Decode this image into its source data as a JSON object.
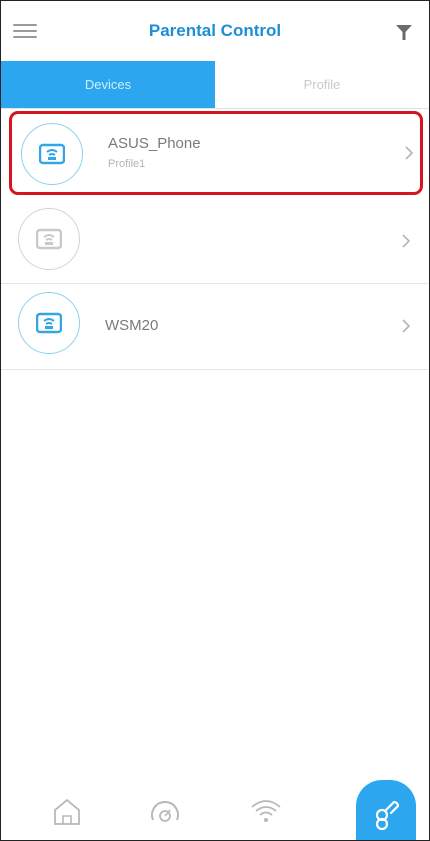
{
  "header": {
    "title": "Parental Control"
  },
  "tabs": [
    {
      "label": "Devices",
      "active": true
    },
    {
      "label": "Profile",
      "active": false
    }
  ],
  "devices": [
    {
      "name": "ASUS_Phone",
      "profile": "Profile1",
      "selected": true
    },
    {
      "name": "",
      "profile": "",
      "selected": false
    },
    {
      "name": "WSM20",
      "profile": "",
      "selected": false
    }
  ],
  "bottom_nav": {
    "items": [
      "home-icon",
      "speedometer-icon",
      "wifi-icon",
      "parental-control-icon"
    ],
    "active_index": 3
  },
  "colors": {
    "accent": "#2ba6ef",
    "title": "#1e8ed6",
    "highlight": "#d4151f",
    "icon_grey": "#b8b8b8"
  }
}
